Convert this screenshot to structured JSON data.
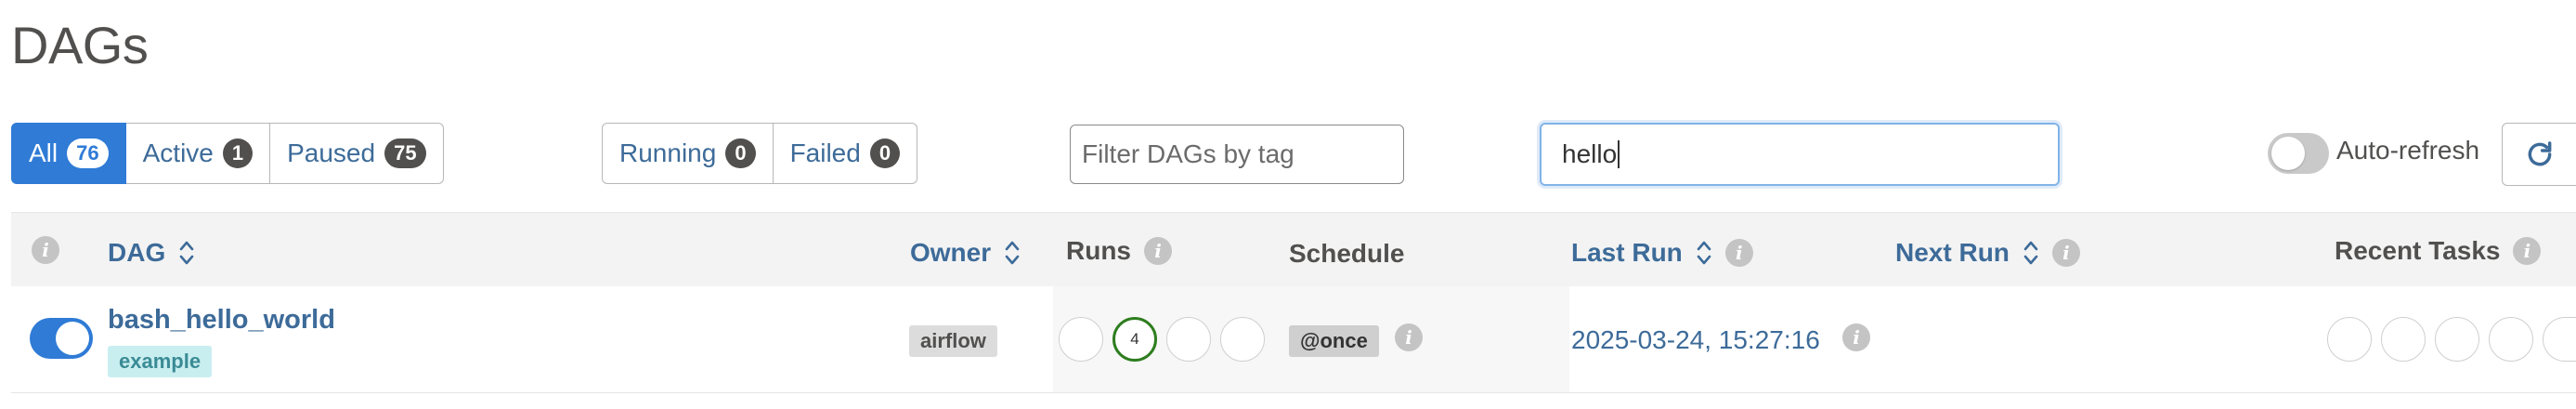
{
  "page": {
    "title": "DAGs"
  },
  "status_filters": {
    "all": {
      "label": "All",
      "count": "76"
    },
    "active": {
      "label": "Active",
      "count": "1"
    },
    "paused": {
      "label": "Paused",
      "count": "75"
    }
  },
  "run_filters": {
    "running": {
      "label": "Running",
      "count": "0"
    },
    "failed": {
      "label": "Failed",
      "count": "0"
    }
  },
  "tag_filter": {
    "placeholder": "Filter DAGs by tag"
  },
  "search": {
    "value": "hello"
  },
  "auto_refresh": {
    "label": "Auto-refresh",
    "enabled": false
  },
  "columns": {
    "dag": "DAG",
    "owner": "Owner",
    "runs": "Runs",
    "schedule": "Schedule",
    "last_run": "Last Run",
    "next_run": "Next Run",
    "recent_tasks": "Recent Tasks"
  },
  "rows": [
    {
      "dag_id": "bash_hello_world",
      "tag": "example",
      "owner": "airflow",
      "paused": false,
      "runs": {
        "success_count": "4"
      },
      "schedule": "@once",
      "last_run": "2025-03-24, 15:27:16",
      "next_run": ""
    }
  ],
  "colors": {
    "accent": "#2f7bd6",
    "link": "#3d6b99",
    "success_ring": "#2e7d1f",
    "tag_bg": "#c9eef0"
  },
  "icons": [
    "info-icon",
    "sort-icon",
    "refresh-icon"
  ]
}
